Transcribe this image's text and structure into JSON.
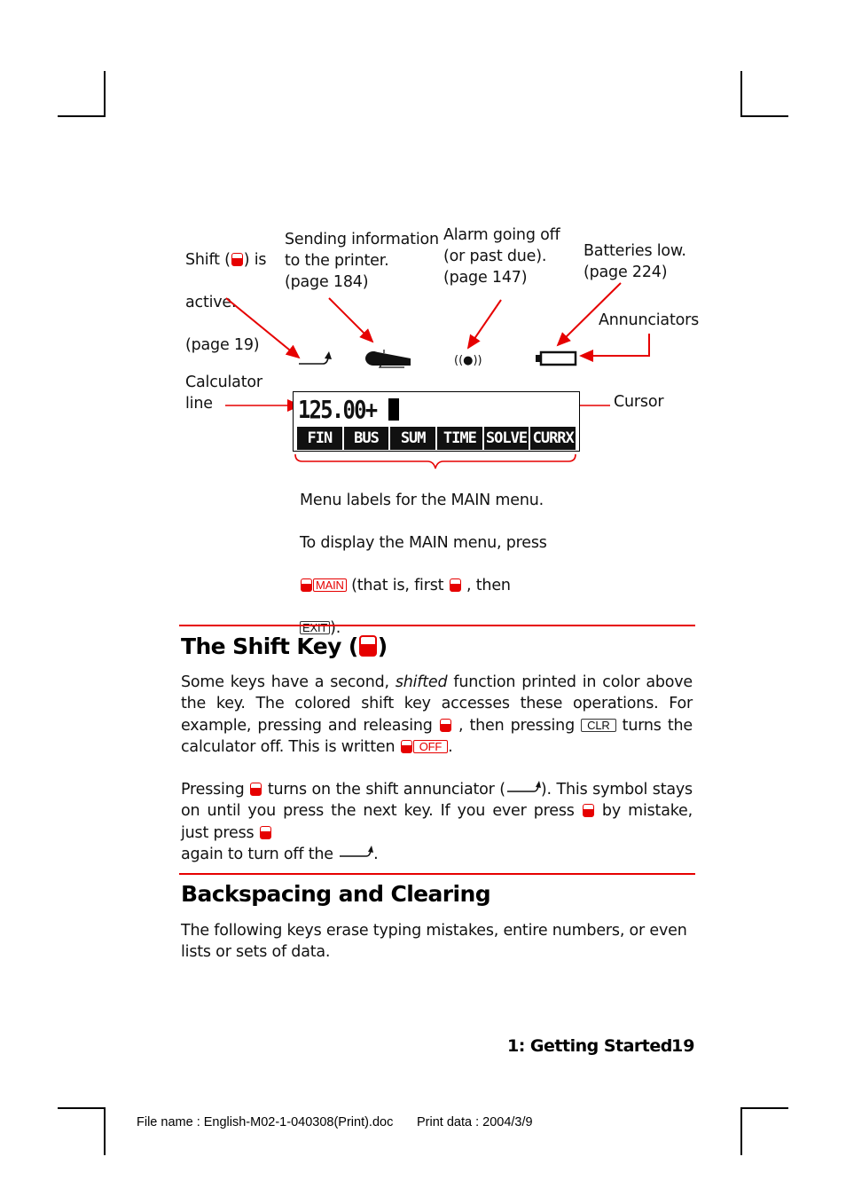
{
  "diagram": {
    "callouts": {
      "shift": "Shift (|SHIFT|) is\nactive.\n(page 19)",
      "shift_line1_pre": "Shift (",
      "shift_line1_post": ") is",
      "shift_line2": "active.",
      "shift_line3": "(page 19)",
      "printer": "Sending information\nto the printer.\n(page 184)",
      "alarm": "Alarm going off\n(or past due).\n(page 147)",
      "battery": "Batteries low.\n(page 224)",
      "annunciators": "Annunciators",
      "calculator_line": "Calculator\nline",
      "cursor": "Cursor"
    },
    "annunciator_icons": [
      "shift-annunciator-icon",
      "printer-icon",
      "alarm-icon",
      "battery-low-icon"
    ],
    "alarm_glyph": "((●))",
    "display": {
      "calculator_line": "125.00+",
      "menu_labels": [
        "FIN",
        "BUS",
        "SUM",
        "TIME",
        "SOLVE",
        "CURRX"
      ]
    },
    "menu_caption": {
      "line1": "Menu labels for the MAIN menu.",
      "line2": "To display the MAIN menu, press",
      "main_key": "MAIN",
      "line3_mid": " (that is, first ",
      "line3_end": " , then",
      "exit_key": "EXIT",
      "line4_end": ")."
    }
  },
  "sections": [
    {
      "title_pre": "The Shift Key (",
      "title_post": ")",
      "p1": {
        "a": "Some keys have a second, ",
        "em": "shifted",
        "b": " function printed in color above the key. The colored shift key accesses these operations. For example, pressing and releasing ",
        "c": " , then pressing ",
        "clr_key": "CLR",
        "d": " turns the calculator off. This is written ",
        "off_key": "OFF",
        "e": "."
      },
      "p2": {
        "a": "Pressing ",
        "b": " turns on the shift annunciator (",
        "c": "). This symbol stays on until you press the next key. If you ever press ",
        "d": " by mistake, just press ",
        "e": " again to turn off the ",
        "f": "."
      }
    },
    {
      "title": "Backspacing and Clearing",
      "p1": "The following keys erase typing mistakes, entire numbers, or even lists or sets of data."
    }
  ],
  "footer": {
    "chapter": "1: Getting Started",
    "page": "19",
    "file_name": "File name : English-M02-1-040308(Print).doc",
    "print_date": "Print data : 2004/3/9"
  },
  "colors": {
    "accent_red": "#e60000",
    "text": "#111111"
  }
}
